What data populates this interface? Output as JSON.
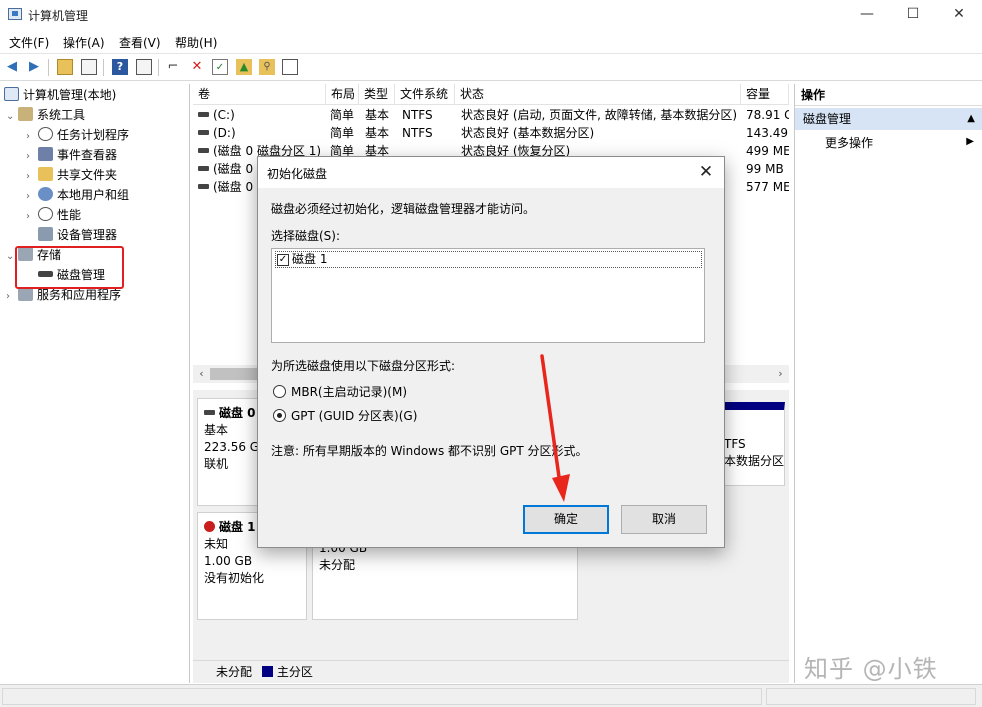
{
  "window": {
    "title": "计算机管理",
    "minimize": "—",
    "maximize": "☐",
    "close": "✕"
  },
  "menu": [
    "文件(F)",
    "操作(A)",
    "查看(V)",
    "帮助(H)"
  ],
  "tree": {
    "root": "计算机管理(本地)",
    "system_tools": "系统工具",
    "task_scheduler": "任务计划程序",
    "event_viewer": "事件查看器",
    "shared_folders": "共享文件夹",
    "local_users": "本地用户和组",
    "performance": "性能",
    "device_manager": "设备管理器",
    "storage": "存储",
    "disk_management": "磁盘管理",
    "services_apps": "服务和应用程序"
  },
  "volume_table": {
    "columns": [
      "卷",
      "布局",
      "类型",
      "文件系统",
      "状态",
      "容量"
    ],
    "rows": [
      [
        "(C:)",
        "简单",
        "基本",
        "NTFS",
        "状态良好 (启动, 页面文件, 故障转储, 基本数据分区)",
        "78.91 G"
      ],
      [
        "(D:)",
        "简单",
        "基本",
        "NTFS",
        "状态良好 (基本数据分区)",
        "143.49"
      ],
      [
        "(磁盘 0 磁盘分区 1)",
        "简单",
        "基本",
        "",
        "状态良好 (恢复分区)",
        "499 ME"
      ],
      [
        "(磁盘 0",
        "",
        "",
        "",
        "",
        "99 MB"
      ],
      [
        "(磁盘 0",
        "",
        "",
        "",
        "",
        "577 ME"
      ]
    ]
  },
  "disks": {
    "disk0": {
      "name": "磁盘 0",
      "type": "基本",
      "size": "223.56 GB",
      "state": "联机",
      "part_fs": "TFS",
      "part_status": "本数据分区"
    },
    "disk1": {
      "name": "磁盘 1",
      "type": "未知",
      "size": "1.00 GB",
      "state": "没有初始化",
      "part_size": "1.00 GB",
      "part_status": "未分配"
    }
  },
  "legend": {
    "unallocated": "未分配",
    "primary": "主分区"
  },
  "actions": {
    "header": "操作",
    "selected": "磁盘管理",
    "more": "更多操作"
  },
  "dialog": {
    "title": "初始化磁盘",
    "message": "磁盘必须经过初始化，逻辑磁盘管理器才能访问。",
    "select_label": "选择磁盘(S):",
    "disk_items": [
      {
        "label": "磁盘 1",
        "checked": true
      }
    ],
    "format_label": "为所选磁盘使用以下磁盘分区形式:",
    "options": [
      {
        "label": "MBR(主启动记录)(M)",
        "selected": false
      },
      {
        "label": "GPT (GUID 分区表)(G)",
        "selected": true
      }
    ],
    "note": "注意: 所有早期版本的 Windows 都不识别 GPT 分区形式。",
    "ok": "确定",
    "cancel": "取消"
  },
  "watermark": "知乎 @小铁",
  "colors": {
    "primary_partition": "#000080",
    "unallocated": "#000000",
    "highlight": "#e02020",
    "arrow": "#e8261c",
    "selection": "#d6e4f5"
  }
}
